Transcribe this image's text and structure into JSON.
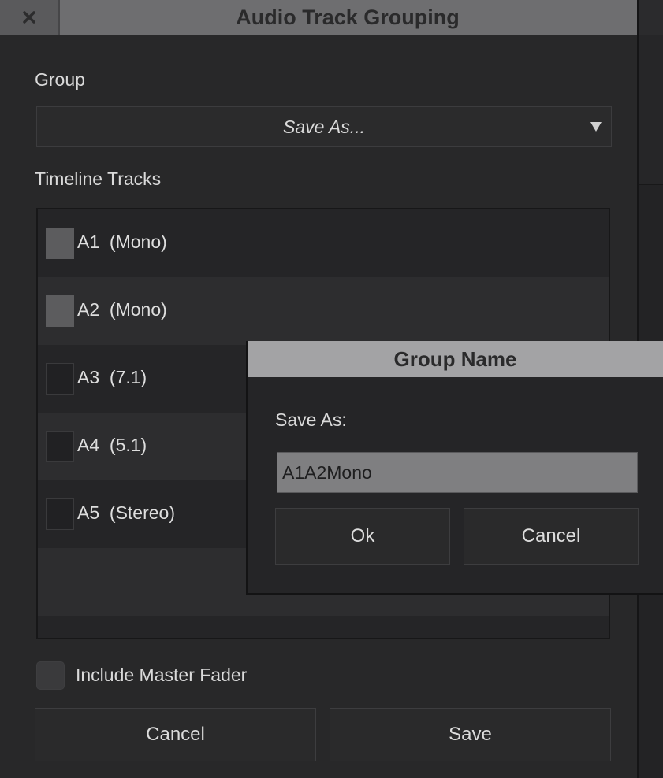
{
  "window": {
    "title": "Audio Track Grouping",
    "close_icon": "close-icon"
  },
  "group": {
    "label": "Group",
    "dropdown_value": "Save As..."
  },
  "timeline": {
    "label": "Timeline Tracks",
    "tracks": [
      {
        "id": "A1",
        "type": "(Mono)",
        "checked": true
      },
      {
        "id": "A2",
        "type": "(Mono)",
        "checked": true
      },
      {
        "id": "A3",
        "type": "(7.1)",
        "checked": false
      },
      {
        "id": "A4",
        "type": "(5.1)",
        "checked": false
      },
      {
        "id": "A5",
        "type": "(Stereo)",
        "checked": false
      }
    ]
  },
  "master": {
    "label": "Include Master Fader",
    "checked": false
  },
  "footer": {
    "cancel_label": "Cancel",
    "save_label": "Save"
  },
  "popup": {
    "title": "Group Name",
    "field_label": "Save As:",
    "field_value": "A1A2Mono",
    "ok_label": "Ok",
    "cancel_label": "Cancel"
  },
  "colors": {
    "background": "#282829",
    "titlebar": "#6e6e70",
    "popup_titlebar": "#a3a3a5",
    "checkbox_checked": "#5c5c5e",
    "input_bg": "#7f7f81"
  }
}
